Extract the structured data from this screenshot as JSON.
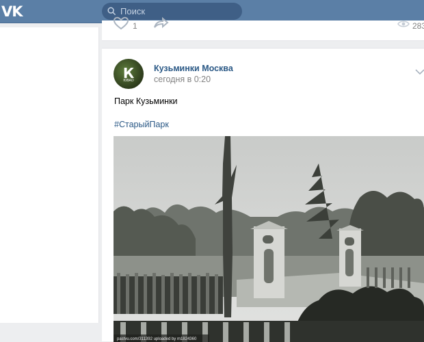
{
  "header": {
    "logo_text": "VK",
    "search_placeholder": "Поиск"
  },
  "previous_post": {
    "like_count": "1",
    "view_count": "283"
  },
  "post": {
    "author": "Кузьминки Москва",
    "time": "сегодня в 0:20",
    "avatar_letter": "К",
    "avatar_sub": "ЮВАО",
    "text": "Парк Кузьминки",
    "hashtag": "#СтарыйПарк",
    "photo_credit": "pastvu.com/311392  uploaded by m1824360"
  },
  "colors": {
    "header": "#5b7fa6",
    "search": "#3f5f86",
    "link": "#2a5885",
    "muted": "#828282",
    "background": "#edeef0"
  }
}
